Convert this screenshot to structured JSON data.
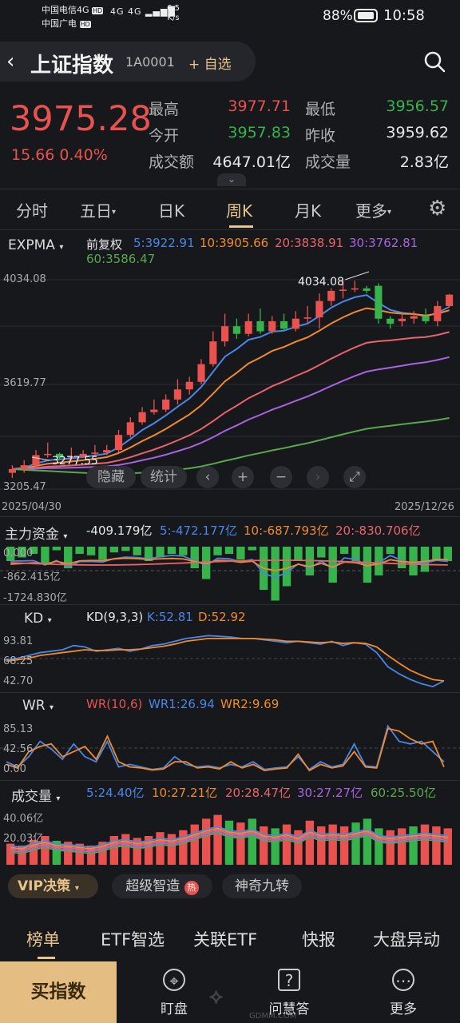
{
  "status_bar": {
    "carrier1": "中国电信4G",
    "carrier2": "中国广电",
    "hd1": "HD",
    "hd2": "HD",
    "signal": "4G 4G",
    "speed": "6.5 K/s",
    "battery": "88%",
    "time": "10:58"
  },
  "header": {
    "title": "上证指数",
    "code": "1A0001",
    "add_label": "+ 自选"
  },
  "quote": {
    "price": "3975.28",
    "change": "15.66 0.40%",
    "high_label": "最高",
    "high": "3977.71",
    "low_label": "最低",
    "low": "3956.57",
    "open_label": "今开",
    "open": "3957.83",
    "prev_label": "昨收",
    "prev": "3959.62",
    "amount_label": "成交额",
    "amount": "4647.01亿",
    "volume_label": "成交量",
    "volume": "2.83亿"
  },
  "tabs": [
    "分时",
    "五日",
    "日K",
    "周K",
    "月K",
    "更多"
  ],
  "active_tab": "周K",
  "main_chart": {
    "indicator": "EXPMA",
    "adjust": "前复权",
    "ma5": "5:3922.91",
    "ma10": "10:3905.66",
    "ma20": "20:3838.91",
    "ma30": "30:3762.81",
    "ma60": "60:3586.47",
    "y_top": "4034.08",
    "y_mid": "3619.77",
    "y_bottom": "3205.47",
    "high_mark": "4034.08",
    "low_mark": "3277.55",
    "date_start": "2025/04/30",
    "date_end": "2025/12/26",
    "hide_label": "隐藏",
    "stats_label": "统计"
  },
  "fund_panel": {
    "indicator": "主力资金",
    "value": "-409.179亿",
    "f5": "5:-472.177亿",
    "f10": "10:-687.793亿",
    "f20": "20:-830.706亿",
    "y_top": "0.000",
    "y_mid": "-862.415亿",
    "y_bottom": "-1724.830亿"
  },
  "kd_panel": {
    "indicator": "KD",
    "param": "KD(9,3,3)",
    "k": "K:52.81",
    "d": "D:52.92",
    "y_top": "93.81",
    "y_mid": "68.25",
    "y_bottom": "42.70"
  },
  "wr_panel": {
    "indicator": "WR",
    "param": "WR(10,6)",
    "wr1": "WR1:26.94",
    "wr2": "WR2:9.69",
    "y_top": "85.13",
    "y_mid": "42.56",
    "y_bottom": "0.00"
  },
  "vol_panel": {
    "indicator": "成交量",
    "v5": "5:24.40亿",
    "v10": "10:27.21亿",
    "v20": "20:28.47亿",
    "v30": "30:27.27亿",
    "v60": "60:25.50亿",
    "y_top": "40.06亿",
    "y_mid": "20.03亿"
  },
  "decision": {
    "vip": "VIP决策",
    "pill1": "超级智造",
    "pill2": "神奇九转"
  },
  "bottom_tabs": [
    "榜单",
    "ETF智选",
    "关联ETF",
    "快报",
    "大盘异动"
  ],
  "bottom_bar": {
    "buy": "买指数",
    "watch": "盯盘",
    "ask": "问慧答",
    "more": "更多"
  },
  "watermark": "GDMM.COM",
  "colors": {
    "up": "#e9524f",
    "down": "#36b34a",
    "accent": "#e8c48c",
    "ma5": "#4a86e8",
    "ma10": "#f08a2c",
    "ma20": "#e8646a",
    "ma30": "#a864e0",
    "ma60": "#5aa84e"
  },
  "chart_data": [
    {
      "type": "candlestick",
      "title": "上证指数 周K",
      "ylim": [
        3205.47,
        4034.08
      ],
      "x_range": [
        "2025/04/30",
        "2025/12/26"
      ],
      "candles": [
        {
          "o": 3270,
          "c": 3285,
          "h": 3300,
          "l": 3250
        },
        {
          "o": 3285,
          "c": 3300,
          "h": 3320,
          "l": 3270
        },
        {
          "o": 3300,
          "c": 3340,
          "h": 3360,
          "l": 3290
        },
        {
          "o": 3340,
          "c": 3345,
          "h": 3390,
          "l": 3330
        },
        {
          "o": 3345,
          "c": 3330,
          "h": 3350,
          "l": 3320
        },
        {
          "o": 3330,
          "c": 3335,
          "h": 3370,
          "l": 3320
        },
        {
          "o": 3335,
          "c": 3345,
          "h": 3360,
          "l": 3330
        },
        {
          "o": 3345,
          "c": 3350,
          "h": 3380,
          "l": 3335
        },
        {
          "o": 3350,
          "c": 3360,
          "h": 3380,
          "l": 3340
        },
        {
          "o": 3360,
          "c": 3420,
          "h": 3440,
          "l": 3350
        },
        {
          "o": 3420,
          "c": 3470,
          "h": 3490,
          "l": 3410
        },
        {
          "o": 3470,
          "c": 3510,
          "h": 3530,
          "l": 3460
        },
        {
          "o": 3510,
          "c": 3520,
          "h": 3560,
          "l": 3500
        },
        {
          "o": 3520,
          "c": 3560,
          "h": 3580,
          "l": 3510
        },
        {
          "o": 3560,
          "c": 3600,
          "h": 3640,
          "l": 3540
        },
        {
          "o": 3600,
          "c": 3630,
          "h": 3650,
          "l": 3580
        },
        {
          "o": 3630,
          "c": 3700,
          "h": 3720,
          "l": 3620
        },
        {
          "o": 3700,
          "c": 3790,
          "h": 3830,
          "l": 3690
        },
        {
          "o": 3790,
          "c": 3850,
          "h": 3900,
          "l": 3770
        },
        {
          "o": 3850,
          "c": 3820,
          "h": 3880,
          "l": 3800
        },
        {
          "o": 3820,
          "c": 3870,
          "h": 3900,
          "l": 3810
        },
        {
          "o": 3870,
          "c": 3830,
          "h": 3920,
          "l": 3820
        },
        {
          "o": 3830,
          "c": 3870,
          "h": 3890,
          "l": 3820
        },
        {
          "o": 3870,
          "c": 3840,
          "h": 3900,
          "l": 3830
        },
        {
          "o": 3840,
          "c": 3880,
          "h": 3910,
          "l": 3830
        },
        {
          "o": 3880,
          "c": 3885,
          "h": 3930,
          "l": 3860
        },
        {
          "o": 3885,
          "c": 3950,
          "h": 3980,
          "l": 3840
        },
        {
          "o": 3950,
          "c": 3990,
          "h": 4000,
          "l": 3930
        },
        {
          "o": 3990,
          "c": 3995,
          "h": 4034,
          "l": 3960
        },
        {
          "o": 3995,
          "c": 4000,
          "h": 4030,
          "l": 3985
        },
        {
          "o": 4000,
          "c": 3990,
          "h": 4010,
          "l": 3980
        },
        {
          "o": 4010,
          "c": 3880,
          "h": 4020,
          "l": 3860
        },
        {
          "o": 3880,
          "c": 3860,
          "h": 3890,
          "l": 3840
        },
        {
          "o": 3870,
          "c": 3880,
          "h": 3900,
          "l": 3850
        },
        {
          "o": 3880,
          "c": 3890,
          "h": 3910,
          "l": 3860
        },
        {
          "o": 3890,
          "c": 3870,
          "h": 3920,
          "l": 3860
        },
        {
          "o": 3870,
          "c": 3930,
          "h": 3950,
          "l": 3850
        },
        {
          "o": 3930,
          "c": 3975,
          "h": 3978,
          "l": 3925
        }
      ]
    }
  ]
}
